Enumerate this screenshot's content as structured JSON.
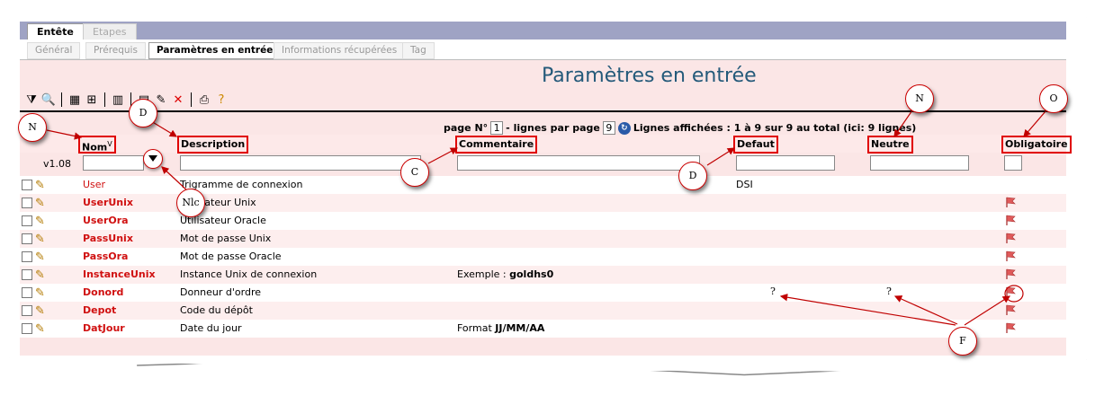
{
  "tabs": {
    "main": [
      "Entête",
      "Etapes"
    ]
  },
  "subtabs": [
    "Général",
    "Prérequis",
    "Paramètres en entrée",
    "Informations récupérées",
    "Tag"
  ],
  "title": "Paramètres en entrée",
  "pagination": {
    "page_label": "page N°",
    "page_value": "1",
    "lines_label": "- lignes par page",
    "lines_value": "9",
    "summary": "Lignes affichées : 1 à 9 sur 9 au total (ici: 9 lignes)"
  },
  "columns": {
    "nom": "Nom",
    "description": "Description",
    "commentaire": "Commentaire",
    "defaut": "Defaut",
    "neutre": "Neutre",
    "obligatoire": "Obligatoire"
  },
  "sort_indicator": "V",
  "version": "v1.08",
  "rows": [
    {
      "nom": "User",
      "description": "Trigramme de connexion",
      "commentaire": "",
      "defaut": "DSI",
      "obligatoire": false
    },
    {
      "nom": "UserUnix",
      "description": "Utilisateur Unix",
      "commentaire": "",
      "defaut": "",
      "obligatoire": true
    },
    {
      "nom": "UserOra",
      "description": "Utilisateur Oracle",
      "commentaire": "",
      "defaut": "",
      "obligatoire": true
    },
    {
      "nom": "PassUnix",
      "description": "Mot de passe Unix",
      "commentaire": "",
      "defaut": "",
      "obligatoire": true
    },
    {
      "nom": "PassOra",
      "description": "Mot de passe Oracle",
      "commentaire": "",
      "defaut": "",
      "obligatoire": true
    },
    {
      "nom": "InstanceUnix",
      "description": "Instance Unix de connexion",
      "commentaire": "Exemple : goldhs0",
      "defaut": "",
      "obligatoire": true
    },
    {
      "nom": "Donord",
      "description": "Donneur d'ordre",
      "commentaire": "",
      "defaut": "",
      "obligatoire": true
    },
    {
      "nom": "Depot",
      "description": "Code du dépôt",
      "commentaire": "",
      "defaut": "",
      "obligatoire": true
    },
    {
      "nom": "DatJour",
      "description": "Date du jour",
      "commentaire": "Format JJ/MM/AA",
      "defaut": "",
      "obligatoire": true
    }
  ],
  "annotations": {
    "n1": "N",
    "d1": "D",
    "c": "C",
    "d2": "D",
    "n2": "N",
    "o": "O",
    "nlc": "Nlc",
    "f": "F",
    "q": "?"
  },
  "colors": {
    "accent": "#245a7a",
    "nom": "#d01010",
    "callout_border": "#c00000",
    "row_pink": "#fdeeee"
  }
}
